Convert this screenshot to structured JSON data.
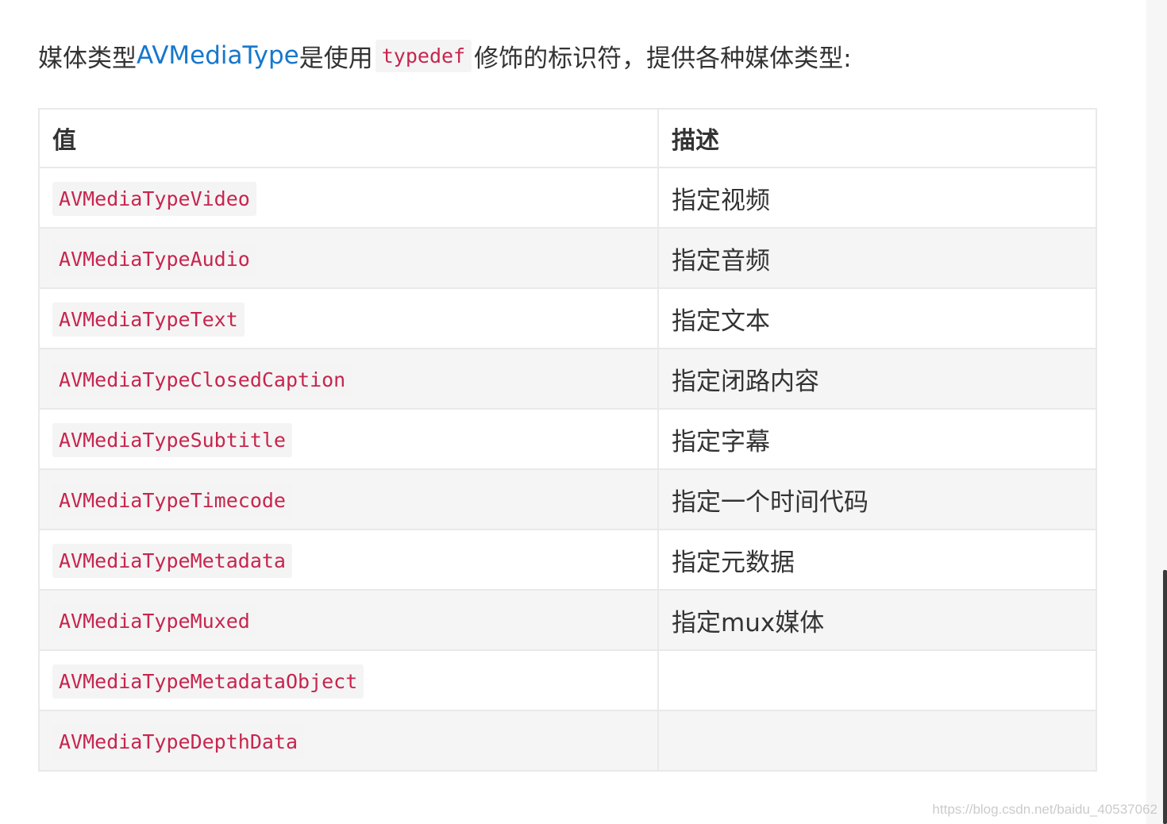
{
  "intro": {
    "prefix": "媒体类型",
    "link": "AVMediaType",
    "middle": "是使用",
    "code": "typedef",
    "suffix": "修饰的标识符，提供各种媒体类型:"
  },
  "table": {
    "headers": [
      "值",
      "描述"
    ],
    "rows": [
      {
        "value": "AVMediaTypeVideo",
        "desc": "指定视频"
      },
      {
        "value": "AVMediaTypeAudio",
        "desc": "指定音频"
      },
      {
        "value": "AVMediaTypeText",
        "desc": "指定文本"
      },
      {
        "value": "AVMediaTypeClosedCaption",
        "desc": "指定闭路内容"
      },
      {
        "value": "AVMediaTypeSubtitle",
        "desc": "指定字幕"
      },
      {
        "value": "AVMediaTypeTimecode",
        "desc": "指定一个时间代码"
      },
      {
        "value": "AVMediaTypeMetadata",
        "desc": "指定元数据"
      },
      {
        "value": "AVMediaTypeMuxed",
        "desc": "指定mux媒体"
      },
      {
        "value": "AVMediaTypeMetadataObject",
        "desc": ""
      },
      {
        "value": "AVMediaTypeDepthData",
        "desc": ""
      }
    ]
  },
  "watermark": "https://blog.csdn.net/baidu_40537062"
}
